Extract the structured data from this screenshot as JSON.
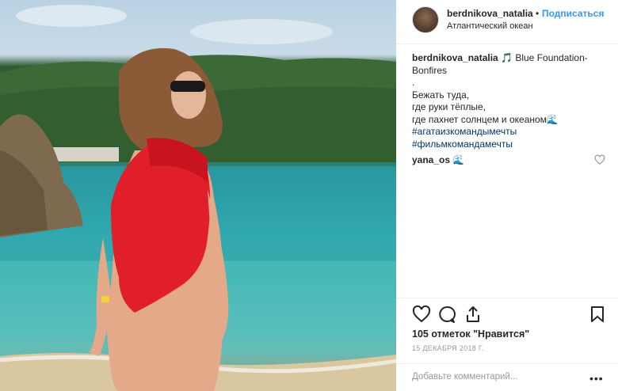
{
  "post": {
    "author": "berdnikova_natalia",
    "dot": "•",
    "follow_label": "Подписаться",
    "location": "Атлантический океан"
  },
  "caption": {
    "author": "berdnikova_natalia",
    "text_first": "🎵 Blue Foundation-Bonfires",
    "line1": ".",
    "line2": "Бежать туда,",
    "line3": "где руки тёплые,",
    "line4": "где пахнет солнцем и океаном🌊",
    "tag1": "#агатаизкомандымечты",
    "tag2": "#фильмкомандамечты"
  },
  "comment": {
    "author": "yana_os",
    "text": "🌊"
  },
  "stats": {
    "likes": "105 отметок \"Нравится\"",
    "date": "15 ДЕКАБРЯ 2018 Г."
  },
  "add_comment": {
    "placeholder": "Добавьте комментарий...",
    "more": "•••"
  },
  "icons": {
    "like": "heart-icon",
    "comment": "comment-icon",
    "share": "share-icon",
    "save": "bookmark-icon",
    "comment_like": "heart-small-icon"
  }
}
